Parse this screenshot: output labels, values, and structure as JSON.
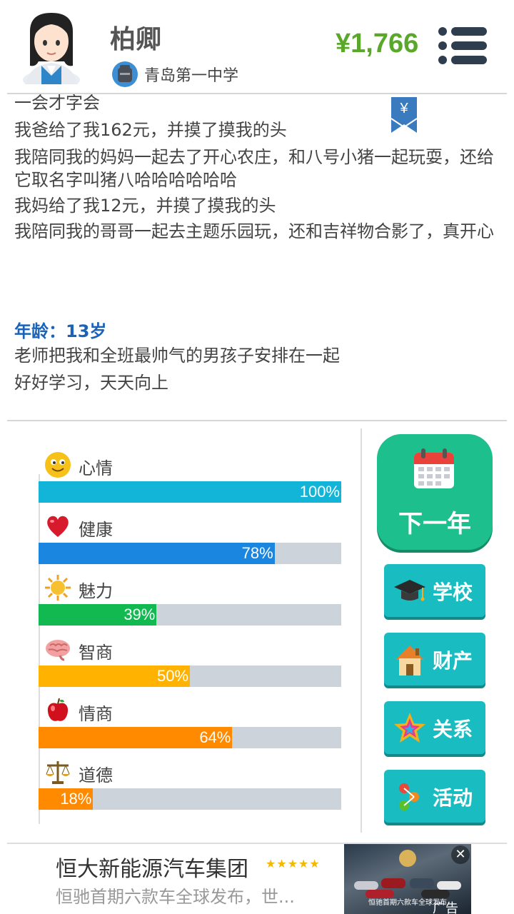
{
  "header": {
    "name": "柏卿",
    "school": "青岛第一中学",
    "money": "¥1,766",
    "bookmark_symbol": "¥"
  },
  "log": {
    "lines_before": [
      "一会才字会",
      "我爸给了我162元，并摸了摸我的头",
      "我陪同我的妈妈一起去了开心农庄，和八号小猪一起玩耍，还给它取名字叫猪八哈哈哈哈哈哈",
      "我妈给了我12元，并摸了摸我的头",
      "我陪同我的哥哥一起去主题乐园玩，还和吉祥物合影了，真开心"
    ],
    "age_label": "年龄：13岁",
    "lines_after": [
      "老师把我和全班最帅气的男孩子安排在一起",
      "好好学习，天天向上"
    ]
  },
  "stats": [
    {
      "label": "心情",
      "value": 100,
      "pct_text": "100%",
      "color": "#12b4d8",
      "icon": "smiley-icon"
    },
    {
      "label": "健康",
      "value": 78,
      "pct_text": "78%",
      "color": "#1a86e0",
      "icon": "heart-icon"
    },
    {
      "label": "魅力",
      "value": 39,
      "pct_text": "39%",
      "color": "#12b850",
      "icon": "sun-icon"
    },
    {
      "label": "智商",
      "value": 50,
      "pct_text": "50%",
      "color": "#ffb300",
      "icon": "brain-icon"
    },
    {
      "label": "情商",
      "value": 64,
      "pct_text": "64%",
      "color": "#ff8a00",
      "icon": "apple-icon"
    },
    {
      "label": "道德",
      "value": 18,
      "pct_text": "18%",
      "color": "#ff8a00",
      "icon": "scales-icon"
    }
  ],
  "buttons": {
    "next_year": "下一年",
    "school": "学校",
    "assets": "财产",
    "relations": "关系",
    "activities": "活动"
  },
  "ad": {
    "title": "恒大新能源汽车集团",
    "stars": "★★★★★",
    "subtitle": "恒驰首期六款车全球发布，世...",
    "image_caption": "恒驰首期六款车全球发布",
    "tag": "广告",
    "close": "✕"
  }
}
